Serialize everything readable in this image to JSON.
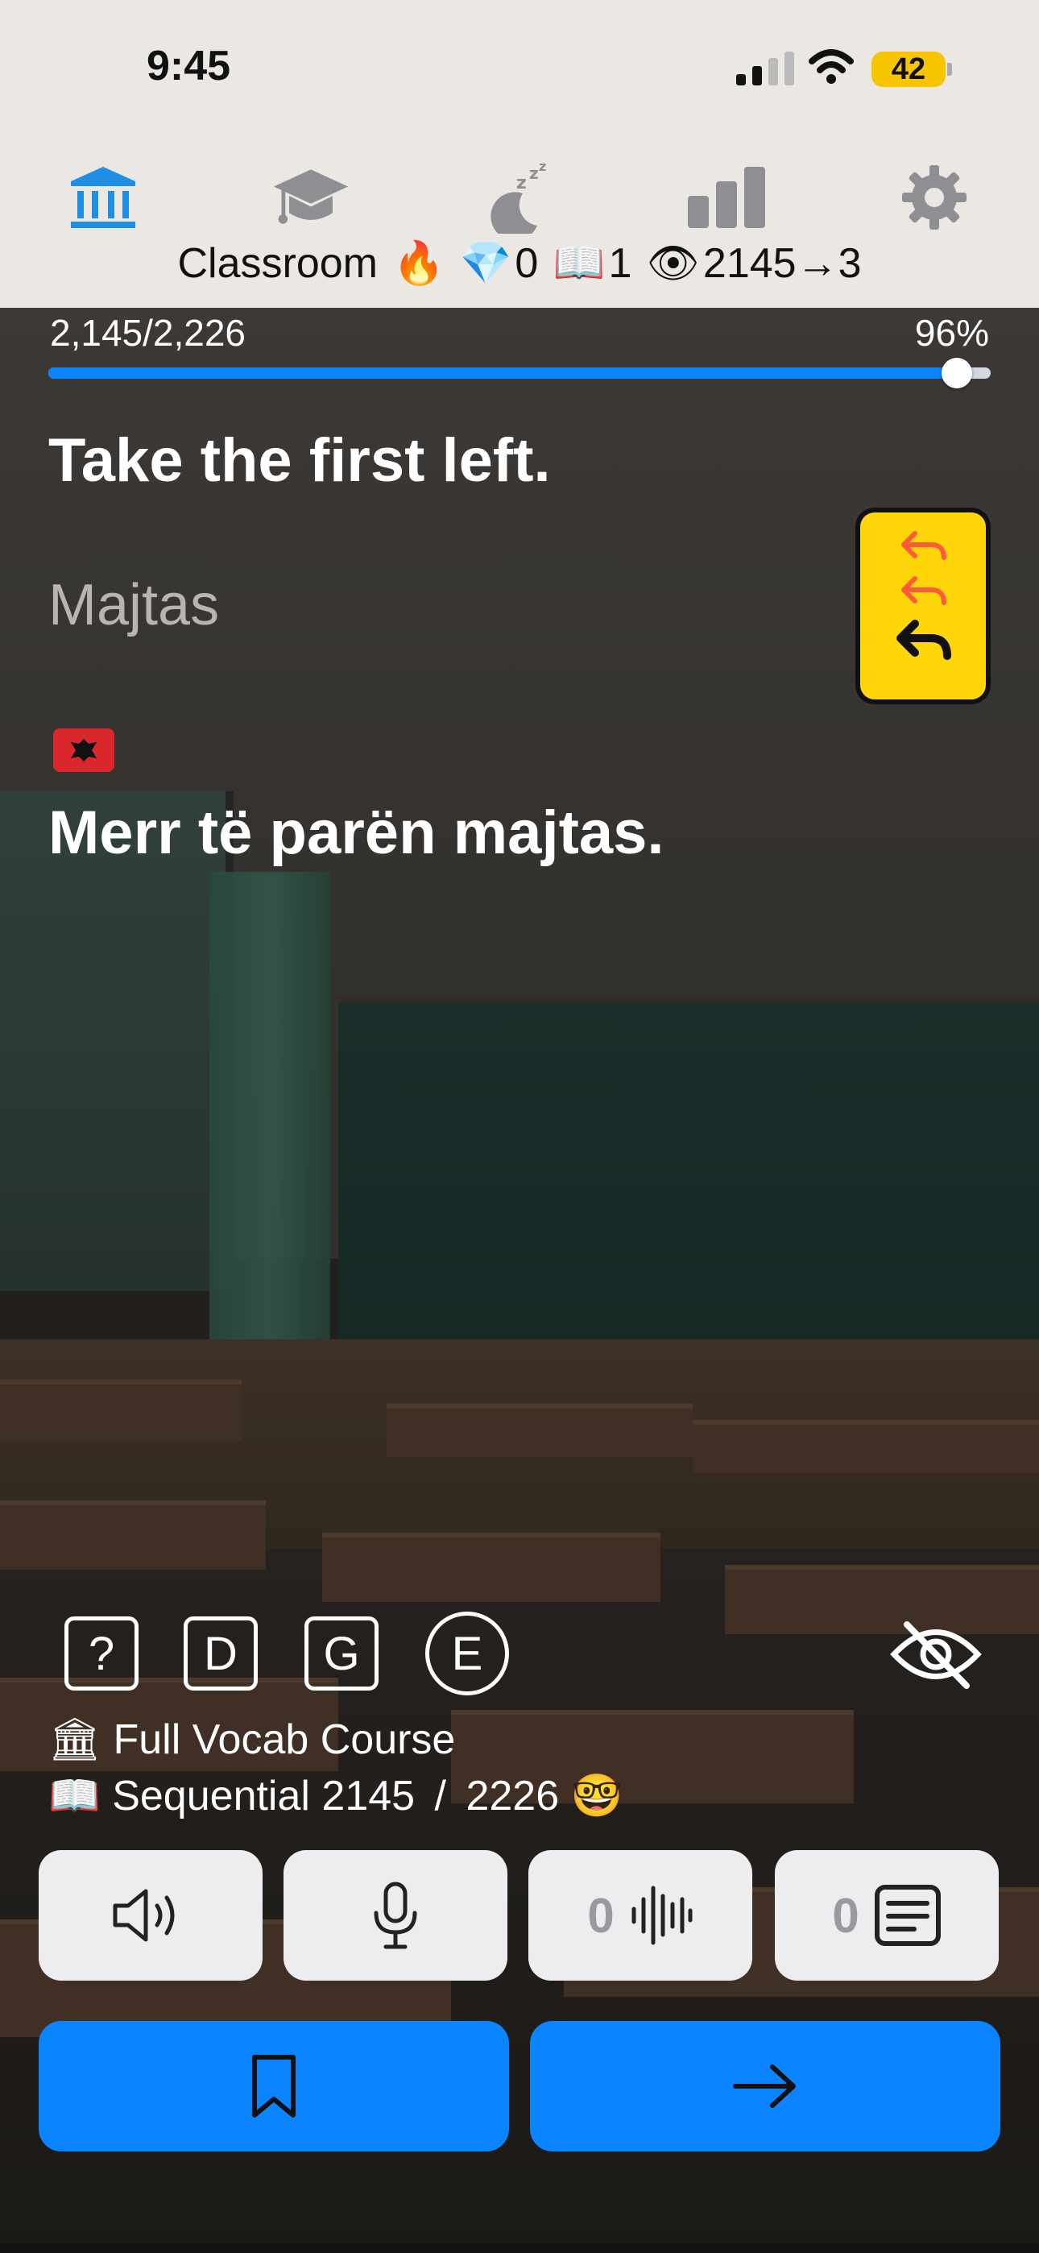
{
  "status_bar": {
    "time": "9:45",
    "battery": "42"
  },
  "tabs": [
    {
      "name": "classroom",
      "icon": "bank-icon",
      "active": true
    },
    {
      "name": "course",
      "icon": "graduation-cap-icon",
      "active": false
    },
    {
      "name": "sleep",
      "icon": "moon-zzz-icon",
      "active": false
    },
    {
      "name": "stats",
      "icon": "bar-chart-icon",
      "active": false
    },
    {
      "name": "settings",
      "icon": "gear-icon",
      "active": false
    }
  ],
  "header": {
    "title": "Classroom",
    "fire": "🔥",
    "gem": "💎",
    "gems": "0",
    "book": "📖",
    "books": "1",
    "eye": "👁",
    "seen": "2145→3"
  },
  "progress": {
    "count": "2,145/2,226",
    "percent_label": "96%",
    "fraction": 0.964
  },
  "card": {
    "english": "Take the first left.",
    "hint": "Majtas",
    "flag": "albania-flag",
    "translation": "Merr të parën majtas."
  },
  "chips": {
    "question": "?",
    "d": "D",
    "g": "G",
    "e": "E"
  },
  "course": {
    "icon1": "🏛",
    "name": "Full Vocab Course",
    "icon2": "📖",
    "mode": "Sequential 2145",
    "sep": "/",
    "total": "2226",
    "emoji": "🤓"
  },
  "buttons": {
    "recordings_count": "0",
    "transcripts_count": "0"
  },
  "colors": {
    "accent": "#0a84ff",
    "sign_yellow": "#ffd60a",
    "tab_active": "#1f8fe5",
    "tab_inactive": "#8e8e93"
  }
}
